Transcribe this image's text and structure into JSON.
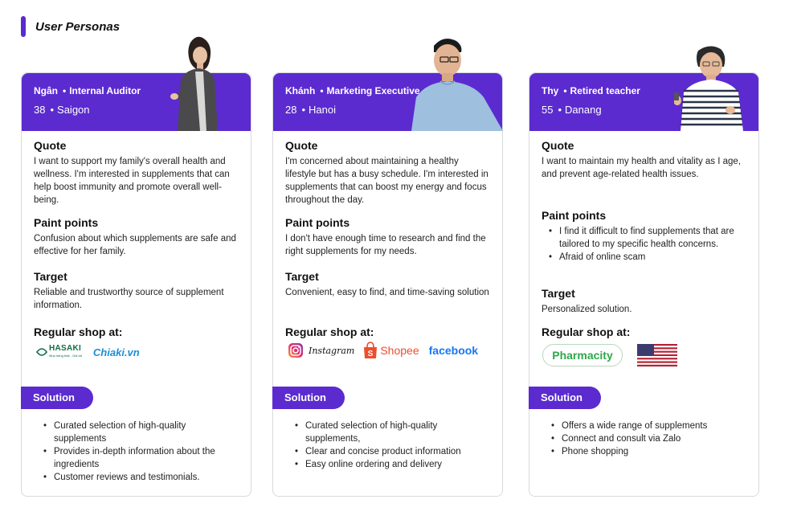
{
  "page": {
    "title": "User Personas"
  },
  "labels": {
    "quote": "Quote",
    "pain": "Paint points",
    "target": "Target",
    "shop": "Regular shop at:",
    "solution": "Solution"
  },
  "personas": [
    {
      "name": "Ngân",
      "role": "Internal Auditor",
      "age": "38",
      "city": "Saigon",
      "quote": "I want to support my family's overall health and wellness. I'm interested in supplements that can help boost immunity and promote overall well-being.",
      "pain": "Confusion about which supplements are safe and effective for her family.",
      "target": "Reliable and trustworthy source of supplement information.",
      "shops": [
        {
          "name": "HASAKI",
          "tagline": "Mua hàng thật - Giá tốt"
        },
        {
          "name": "Chiaki.vn"
        }
      ],
      "solution": [
        "Curated selection of high-quality supplements",
        "Provides in-depth information about the ingredients",
        "Customer reviews and testimonials."
      ]
    },
    {
      "name": "Khánh",
      "role": "Marketing Executive",
      "age": "28",
      "city": "Hanoi",
      "quote": "I'm concerned about maintaining a healthy lifestyle but has a busy schedule. I'm interested in supplements that can boost my energy and focus throughout the day.",
      "pain": "I don't have enough time to research and find the right supplements for my needs.",
      "target": "Convenient, easy to find, and time-saving solution",
      "shops": [
        {
          "name": "Instagram"
        },
        {
          "name": "Shopee"
        },
        {
          "name": "facebook"
        }
      ],
      "solution": [
        "Curated selection of high-quality supplements,",
        "Clear and concise product information",
        "Easy online ordering and delivery"
      ]
    },
    {
      "name": "Thy",
      "role": "Retired teacher",
      "age": "55",
      "city": "Danang",
      "quote": "I want to maintain my health and vitality as I age, and prevent age-related health issues.",
      "pain_list": [
        "I find it difficult to find supplements that are tailored to my specific health concerns.",
        "Afraid of online scam"
      ],
      "target": "Personalized solution.",
      "shops": [
        {
          "name": "Pharmacity"
        },
        {
          "name": "us-flag"
        }
      ],
      "solution": [
        "Offers a wide range of supplements",
        "Connect and consult via Zalo",
        "Phone shopping"
      ]
    }
  ],
  "colors": {
    "brand": "#5b2bd0",
    "border": "#d9d9de",
    "shopee": "#ee4d2d",
    "facebook": "#1877f2",
    "pharmacity": "#2ea84a",
    "hasaki": "#0f6e47",
    "chiaki": "#1c8fd6"
  }
}
